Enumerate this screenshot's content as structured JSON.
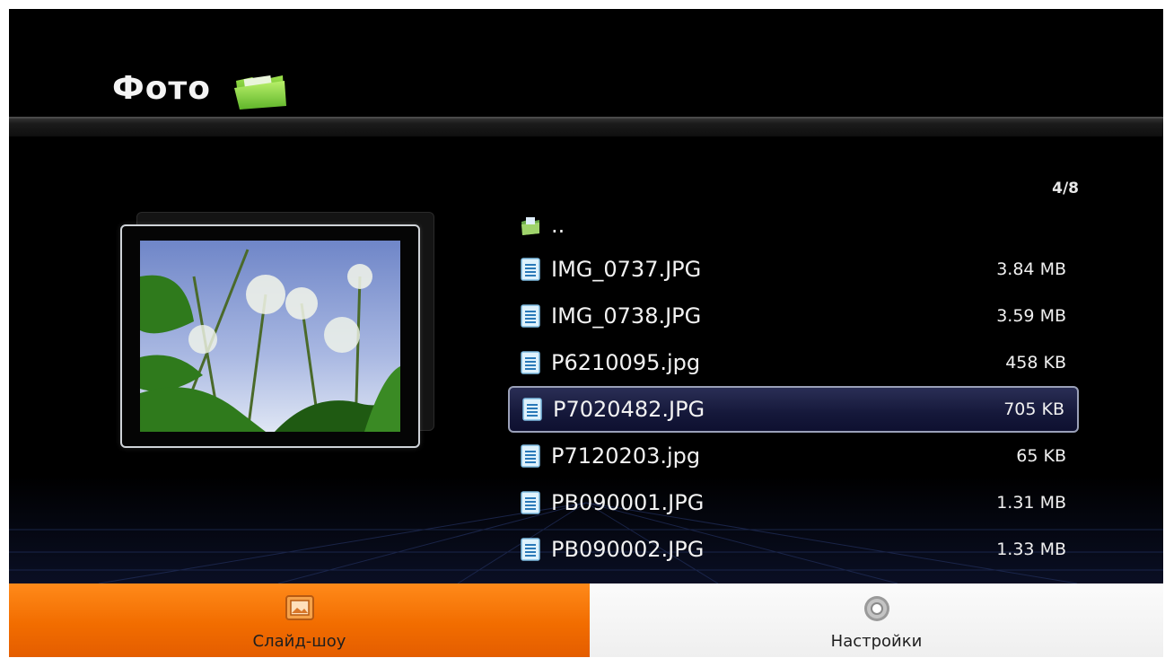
{
  "header": {
    "title": "Фото",
    "title_icon": "folder-icon"
  },
  "page_counter": "4/8",
  "preview": {
    "icon": "photo-thumbnail"
  },
  "file_list": {
    "up_item": {
      "label": "..",
      "icon": "folder-up-icon"
    },
    "items": [
      {
        "name": "IMG_0737.JPG",
        "size": "3.84 MB",
        "icon": "document-icon"
      },
      {
        "name": "IMG_0738.JPG",
        "size": "3.59 MB",
        "icon": "document-icon"
      },
      {
        "name": "P6210095.jpg",
        "size": "458 KB",
        "icon": "document-icon"
      },
      {
        "name": "P7020482.JPG",
        "size": "705 KB",
        "icon": "document-icon",
        "selected": true
      },
      {
        "name": "P7120203.jpg",
        "size": "65 KB",
        "icon": "document-icon"
      },
      {
        "name": "PB090001.JPG",
        "size": "1.31 MB",
        "icon": "document-icon"
      },
      {
        "name": "PB090002.JPG",
        "size": "1.33 MB",
        "icon": "document-icon"
      }
    ]
  },
  "bottom_bar": {
    "slideshow": {
      "label": "Слайд-шоу",
      "icon": "slideshow-icon",
      "active": true
    },
    "settings": {
      "label": "Настройки",
      "icon": "gear-icon"
    }
  },
  "colors": {
    "background": "#000000",
    "active_tab": "#f26d00",
    "inactive_tab": "#f2f2f2",
    "selection": "#15183a",
    "file_icon": "#9fd0f0"
  }
}
